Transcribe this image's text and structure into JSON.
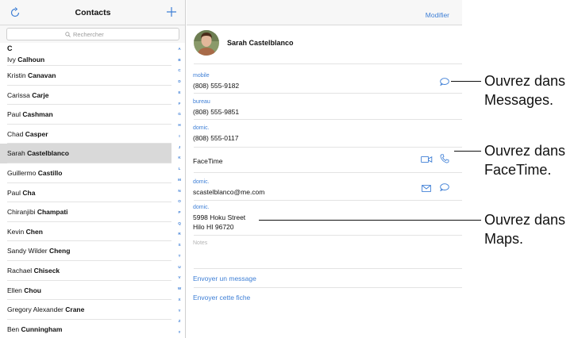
{
  "left_header": {
    "title": "Contacts"
  },
  "search": {
    "placeholder": "Rechercher"
  },
  "section_letter": "C",
  "contacts": [
    {
      "first": "Ivy",
      "last": "Calhoun"
    },
    {
      "first": "Kristin",
      "last": "Canavan"
    },
    {
      "first": "Carissa",
      "last": "Carje"
    },
    {
      "first": "Paul",
      "last": "Cashman"
    },
    {
      "first": "Chad",
      "last": "Casper"
    },
    {
      "first": "Sarah",
      "last": "Castelblanco"
    },
    {
      "first": "Guillermo",
      "last": "Castillo"
    },
    {
      "first": "Paul",
      "last": "Cha"
    },
    {
      "first": "Chiranjibi",
      "last": "Champati"
    },
    {
      "first": "Kevin",
      "last": "Chen"
    },
    {
      "first": "Sandy Wilder",
      "last": "Cheng"
    },
    {
      "first": "Rachael",
      "last": "Chiseck"
    },
    {
      "first": "Ellen",
      "last": "Chou"
    },
    {
      "first": "Gregory Alexander",
      "last": "Crane"
    },
    {
      "first": "Ben",
      "last": "Cunningham"
    }
  ],
  "index_letters": [
    "A",
    "B",
    "C",
    "D",
    "E",
    "F",
    "G",
    "H",
    "I",
    "J",
    "K",
    "L",
    "M",
    "N",
    "O",
    "P",
    "Q",
    "R",
    "S",
    "T",
    "U",
    "V",
    "W",
    "X",
    "Y",
    "Z",
    "#"
  ],
  "right_header": {
    "edit_label": "Modifier"
  },
  "detail": {
    "name": "Sarah Castelblanco",
    "phones": [
      {
        "label": "mobile",
        "value": "(808) 555-9182"
      },
      {
        "label": "bureau",
        "value": "(808) 555-9851"
      },
      {
        "label": "domic.",
        "value": "(808) 555-0117"
      }
    ],
    "facetime_label": "FaceTime",
    "email": {
      "label": "domic.",
      "value": "scastelblanco@me.com"
    },
    "address": {
      "label": "domic.",
      "line1": "5998 Hoku Street",
      "line2": "Hilo HI 96720"
    },
    "notes_label": "Notes",
    "send_message": "Envoyer un message",
    "share_contact": "Envoyer cette fiche"
  },
  "callouts": [
    {
      "line1": "Ouvrez dans",
      "line2": "Messages."
    },
    {
      "line1": "Ouvrez dans",
      "line2": "FaceTime."
    },
    {
      "line1": "Ouvrez dans",
      "line2": "Maps."
    }
  ],
  "colors": {
    "accent": "#3e7fd6",
    "selected_row": "#d9d9d9",
    "separator": "#e3e3e3"
  }
}
